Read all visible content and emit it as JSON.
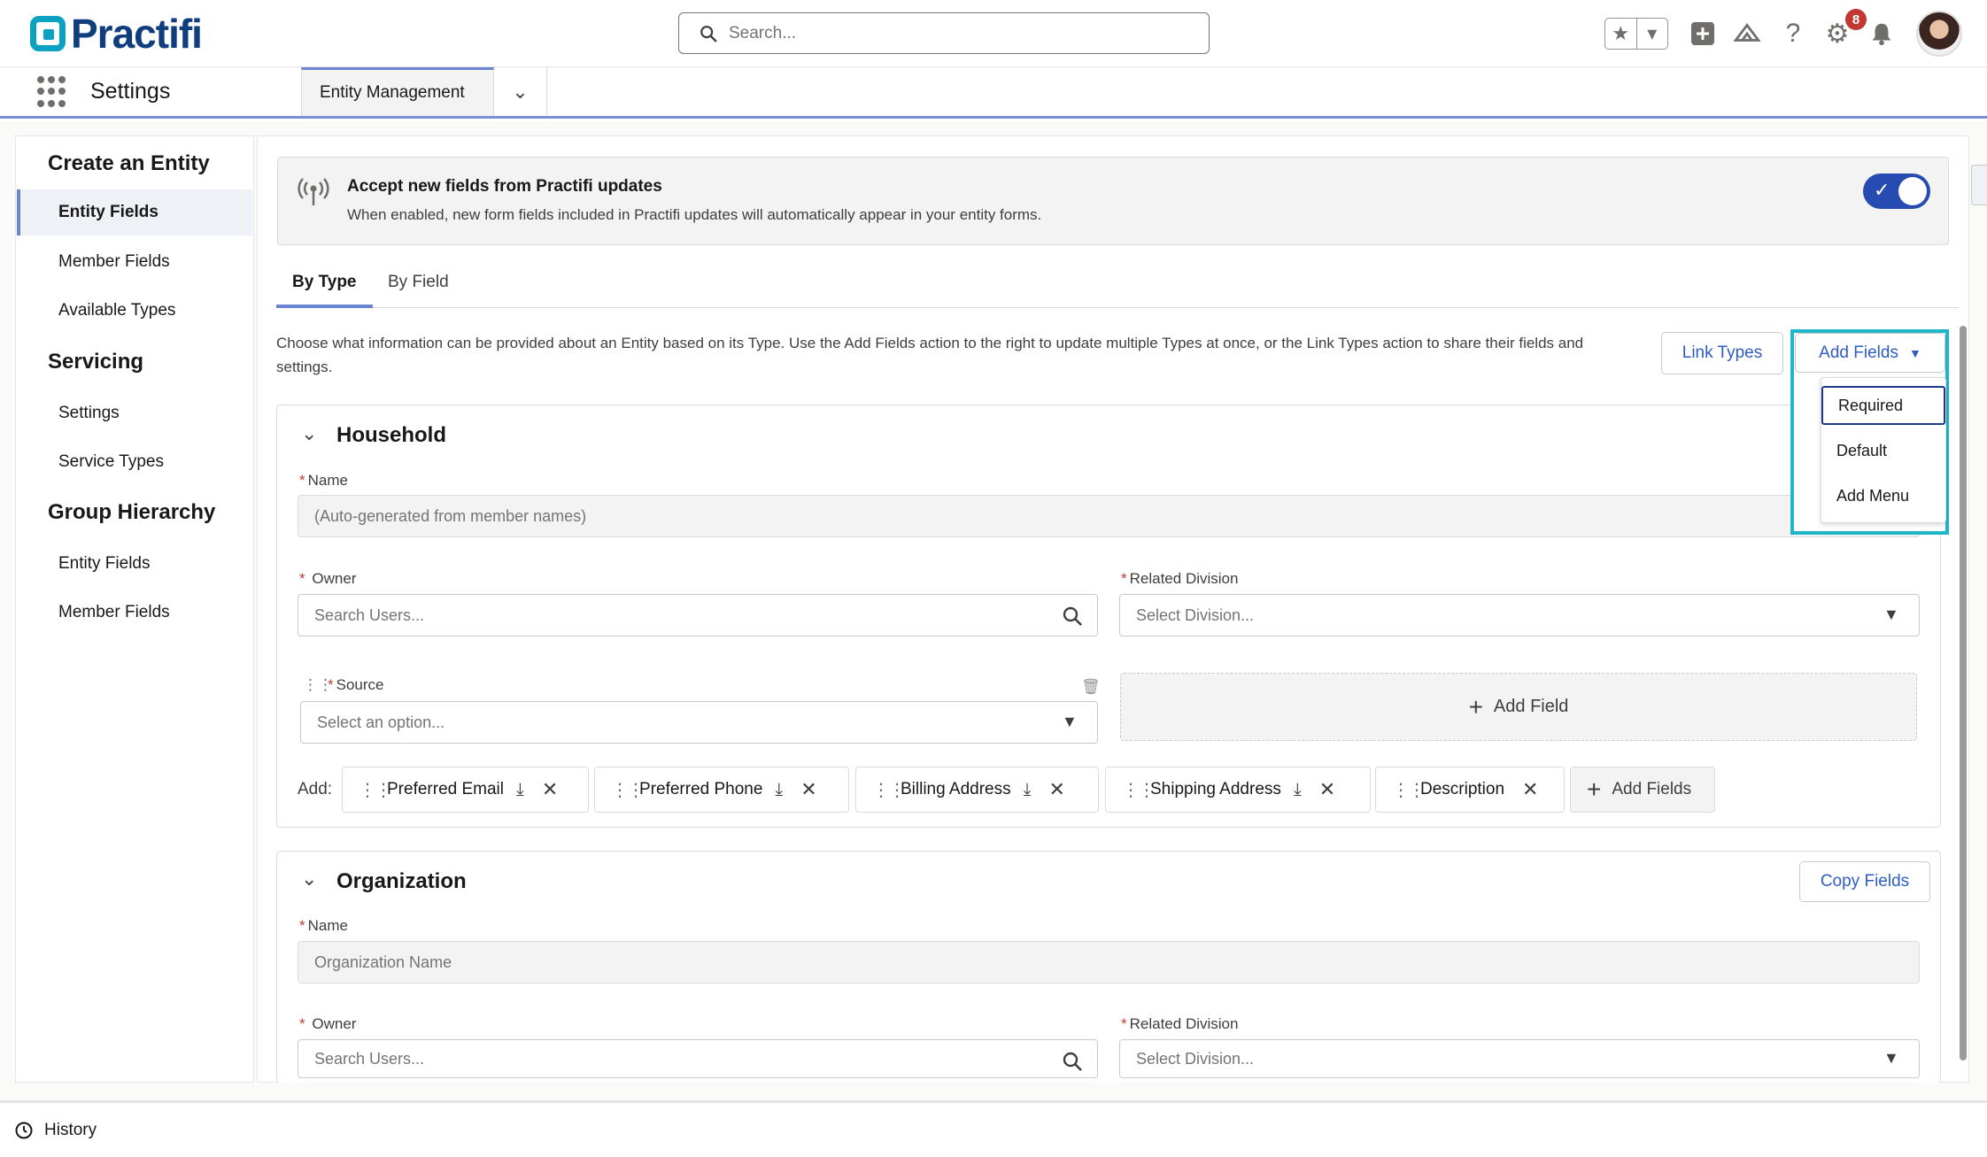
{
  "header": {
    "logo_text": "Practifi",
    "search_placeholder": "Search...",
    "notification_count": "8"
  },
  "appbar": {
    "app_name": "Settings",
    "tab_label": "Entity Management"
  },
  "sidebar": {
    "sections": [
      {
        "title": "Create an Entity",
        "items": [
          "Entity Fields",
          "Member Fields",
          "Available Types"
        ]
      },
      {
        "title": "Servicing",
        "items": [
          "Settings",
          "Service Types"
        ]
      },
      {
        "title": "Group Hierarchy",
        "items": [
          "Entity Fields",
          "Member Fields"
        ]
      }
    ]
  },
  "banner": {
    "title": "Accept new fields from Practifi updates",
    "description": "When enabled, new form fields included in Practifi updates will automatically appear in your entity forms.",
    "toggle_on": true
  },
  "tabs": [
    "By Type",
    "By Field"
  ],
  "intro_text": "Choose what information can be provided about an Entity based on its Type. Use the Add Fields action to the right to update multiple Types at once, or the Link Types action to share their fields and settings.",
  "actions": {
    "link_types": "Link Types",
    "add_fields": "Add Fields",
    "dropdown_items": [
      "Required",
      "Default",
      "Add Menu"
    ]
  },
  "household": {
    "title": "Household",
    "name_label": "Name",
    "name_placeholder": "(Auto-generated from member names)",
    "owner_label": "Owner",
    "owner_placeholder": "Search Users...",
    "division_label": "Related Division",
    "division_placeholder": "Select Division...",
    "source_label": "Source",
    "source_placeholder": "Select an option...",
    "add_field": "Add Field",
    "add_label": "Add:",
    "pills": [
      "Preferred Email",
      "Preferred Phone",
      "Billing Address",
      "Shipping Address",
      "Description"
    ],
    "add_fields_pill": "Add Fields"
  },
  "organization": {
    "title": "Organization",
    "copy_fields": "Copy Fields",
    "name_label": "Name",
    "name_placeholder": "Organization Name",
    "owner_label": "Owner",
    "owner_placeholder": "Search Users...",
    "division_label": "Related Division",
    "division_placeholder": "Select Division..."
  },
  "footer": {
    "history": "History"
  },
  "colors": {
    "accent": "#264bb1",
    "brand_teal": "#0aa2c0",
    "brand_navy": "#103d7e",
    "highlight": "#1fb6cc",
    "required": "#c23934"
  }
}
